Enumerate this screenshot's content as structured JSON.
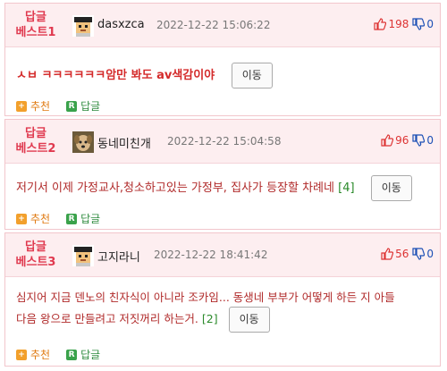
{
  "comments": [
    {
      "best_line1": "답글",
      "best_line2": "베스트1",
      "nickname": "dasxzca",
      "date": "2022-12-22 15:06:22",
      "up": "198",
      "down": "0",
      "text": "ㅅㅂ ㅋㅋㅋㅋㅋㅋ암만 봐도 av색감이야",
      "count": "",
      "move_label": "이동",
      "recommend_label": "추천",
      "reply_label": "답글"
    },
    {
      "best_line1": "답글",
      "best_line2": "베스트2",
      "nickname": "동네미친개",
      "date": "2022-12-22 15:04:58",
      "up": "96",
      "down": "0",
      "text": "저기서 이제 가정교사,청소하고있는 가정부, 집사가 등장할 차례네",
      "count": "[4]",
      "move_label": "이동",
      "recommend_label": "추천",
      "reply_label": "답글"
    },
    {
      "best_line1": "답글",
      "best_line2": "베스트3",
      "nickname": "고지라니",
      "date": "2022-12-22 18:41:42",
      "up": "56",
      "down": "0",
      "text_line1": "심지어 지금 덴노의 친자식이 아니라 조카임... 동생네 부부가 어떻게 하든 지 아들",
      "text_line2": "다음 왕으로 만들려고 저짓꺼리 하는거.",
      "count": "[2]",
      "move_label": "이동",
      "recommend_label": "추천",
      "reply_label": "답글"
    }
  ],
  "colors": {
    "best": "#e0394f",
    "header_bg": "#fdeef0",
    "border": "#f2c6cc",
    "comment_text": "#b02a2a",
    "count": "#2a8a2a"
  }
}
